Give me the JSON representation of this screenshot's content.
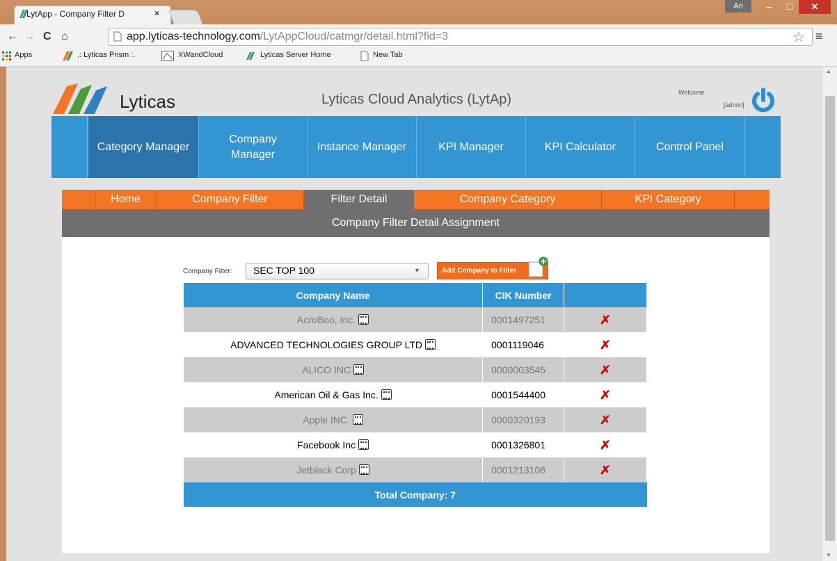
{
  "browser": {
    "tab_title": "LytApp - Company Filter D",
    "tab_close": "×",
    "window_user": "Ari",
    "url_host": "app.lyticas-technology.com",
    "url_path": "/LytAppCloud/catmgr/detail.html?fid=3",
    "bookmarks": [
      {
        "label": "Apps",
        "icon": "apps-grid-icon"
      },
      {
        "label": ".: Lyticas Prism :.",
        "icon": "lyticas-icon"
      },
      {
        "label": "XWandCloud",
        "icon": "xwand-icon"
      },
      {
        "label": "Lyticas Server Home",
        "icon": "lyticas-icon"
      },
      {
        "label": "New Tab",
        "icon": "page-icon"
      }
    ]
  },
  "header": {
    "logo_text": "Lyticas",
    "app_title": "Lyticas Cloud Analytics (LytAp)",
    "welcome": "Welcome",
    "user": "[admin]"
  },
  "main_nav": [
    {
      "label": "Category Manager",
      "active": true
    },
    {
      "label": "Company Manager",
      "active": false
    },
    {
      "label": "Instance Manager",
      "active": false
    },
    {
      "label": "KPI Manager",
      "active": false
    },
    {
      "label": "KPI Calculator",
      "active": false
    },
    {
      "label": "Control Panel",
      "active": false
    }
  ],
  "sub_nav": [
    {
      "label": "Home",
      "active": false
    },
    {
      "label": "Company Filter",
      "active": false
    },
    {
      "label": "Filter Detail",
      "active": true
    },
    {
      "label": "Company Category",
      "active": false
    },
    {
      "label": "KPI Category",
      "active": false
    }
  ],
  "section_title": "Company Filter Detail Assignment",
  "filter": {
    "label": "Company Filter:",
    "selected": "SEC TOP 100",
    "add_button": "Add Company to Filter"
  },
  "table": {
    "headers": [
      "Company Name",
      "CIK Number",
      ""
    ],
    "rows": [
      {
        "name": "AcroBoo, Inc.",
        "cik": "0001497251"
      },
      {
        "name": "ADVANCED TECHNOLOGIES GROUP LTD",
        "cik": "0001119046"
      },
      {
        "name": "ALICO INC",
        "cik": "0000003545"
      },
      {
        "name": "American Oil & Gas Inc.",
        "cik": "0001544400"
      },
      {
        "name": "Apple INC.",
        "cik": "0000320193"
      },
      {
        "name": "Facebook Inc",
        "cik": "0001326801"
      },
      {
        "name": "Jetblack Corp",
        "cik": "0001213106"
      }
    ],
    "total": "Total Company: 7"
  },
  "colors": {
    "nav_blue": "#3396d3",
    "nav_active": "#2a73ab",
    "orange": "#f47523",
    "gray_bar": "#6f6f6f",
    "delete_red": "#d10a0a"
  }
}
